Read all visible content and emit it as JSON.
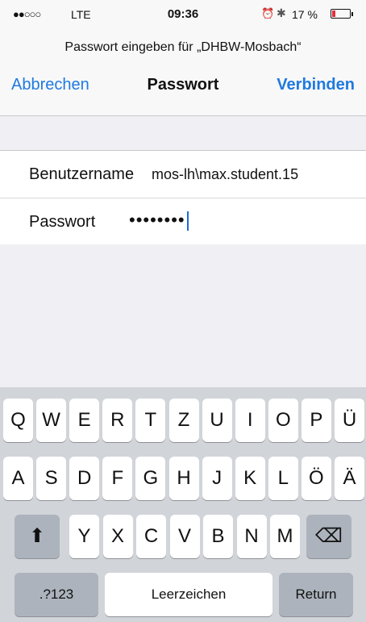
{
  "status": {
    "signal": "●●○○○",
    "carrier": "LTE",
    "time": "09:36",
    "alarm_icon": "⏰",
    "bluetooth_icon": "✱",
    "battery_pct": "17 %",
    "battery_level": 0.17,
    "battery_color": "#e0303a"
  },
  "prompt": "Passwort eingeben für „DHBW-Mosbach“",
  "nav": {
    "cancel": "Abbrechen",
    "title": "Passwort",
    "connect": "Verbinden"
  },
  "form": {
    "username_label": "Benutzername",
    "username_value": "mos-lh\\max.student.15",
    "password_label": "Passwort",
    "password_mask": "••••••••"
  },
  "keyboard": {
    "row1": [
      "Q",
      "W",
      "E",
      "R",
      "T",
      "Z",
      "U",
      "I",
      "O",
      "P",
      "Ü"
    ],
    "row2": [
      "A",
      "S",
      "D",
      "F",
      "G",
      "H",
      "J",
      "K",
      "L",
      "Ö",
      "Ä"
    ],
    "row3": [
      "Y",
      "X",
      "C",
      "V",
      "B",
      "N",
      "M"
    ],
    "shift_icon": "⬆",
    "delete_icon": "⌫",
    "numbers": ".?123",
    "space": "Leerzeichen",
    "return": "Return"
  },
  "colors": {
    "accent": "#1f7ae0"
  }
}
